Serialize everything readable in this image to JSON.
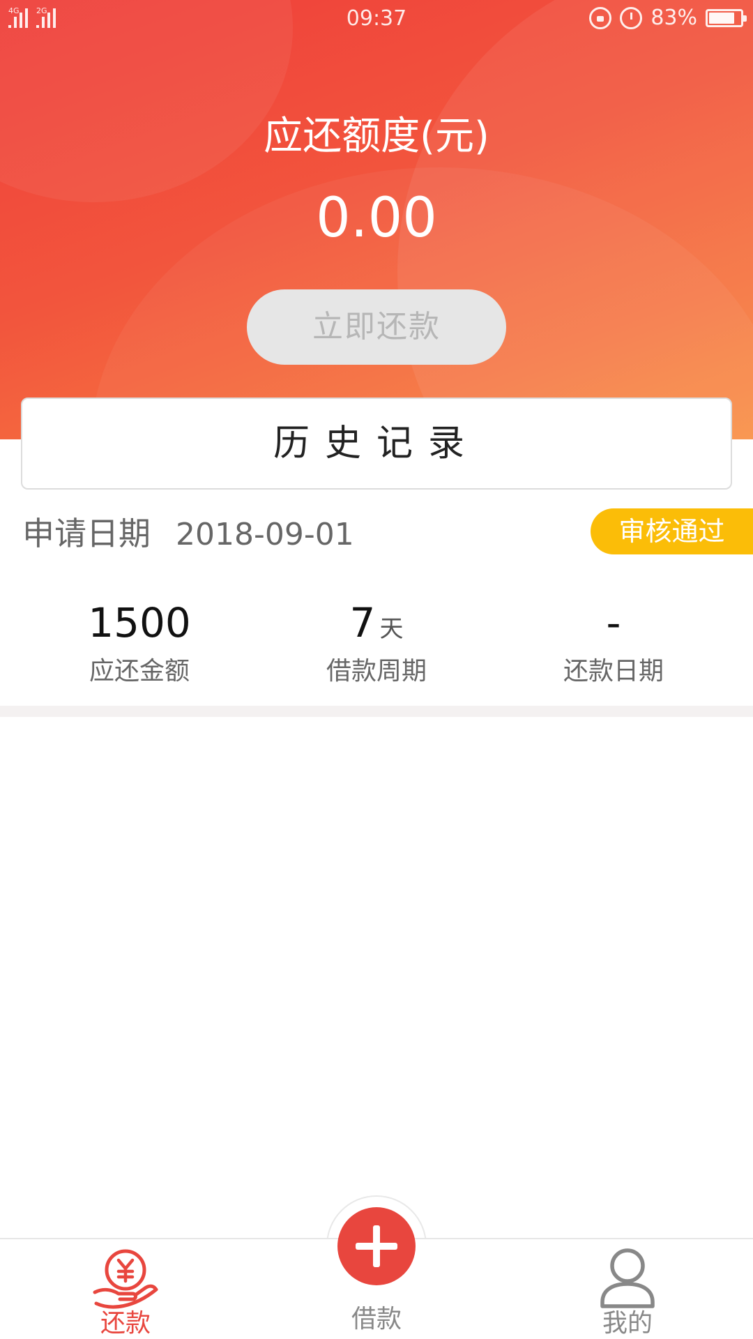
{
  "status_bar": {
    "network_1": "4G",
    "network_2": "2G",
    "time": "09:37",
    "battery_percent": "83%",
    "battery_level": 0.83,
    "icons": [
      "rotation-lock-icon",
      "alarm-icon",
      "battery-icon"
    ]
  },
  "hero": {
    "title": "应还额度(元)",
    "amount": "0.00",
    "repay_button": "立即还款"
  },
  "history": {
    "label": "历史记录"
  },
  "record": {
    "apply_label": "申请日期",
    "apply_date": "2018-09-01",
    "status": "审核通过",
    "stats": [
      {
        "value": "1500",
        "unit": "",
        "label": "应还金额"
      },
      {
        "value": "7",
        "unit": "天",
        "label": "借款周期"
      },
      {
        "value": "-",
        "unit": "",
        "label": "还款日期"
      }
    ]
  },
  "bottom_nav": {
    "items": [
      {
        "label": "还款",
        "icon": "hand-yen-icon",
        "active": true
      },
      {
        "label": "借款",
        "icon": "plus-icon",
        "active": false
      },
      {
        "label": "我的",
        "icon": "user-icon",
        "active": false
      }
    ]
  },
  "colors": {
    "hero_start": "#ef3e3a",
    "hero_end": "#f98b3d",
    "accent": "#e8463e",
    "badge": "#fbbd08",
    "inactive": "#888888"
  }
}
